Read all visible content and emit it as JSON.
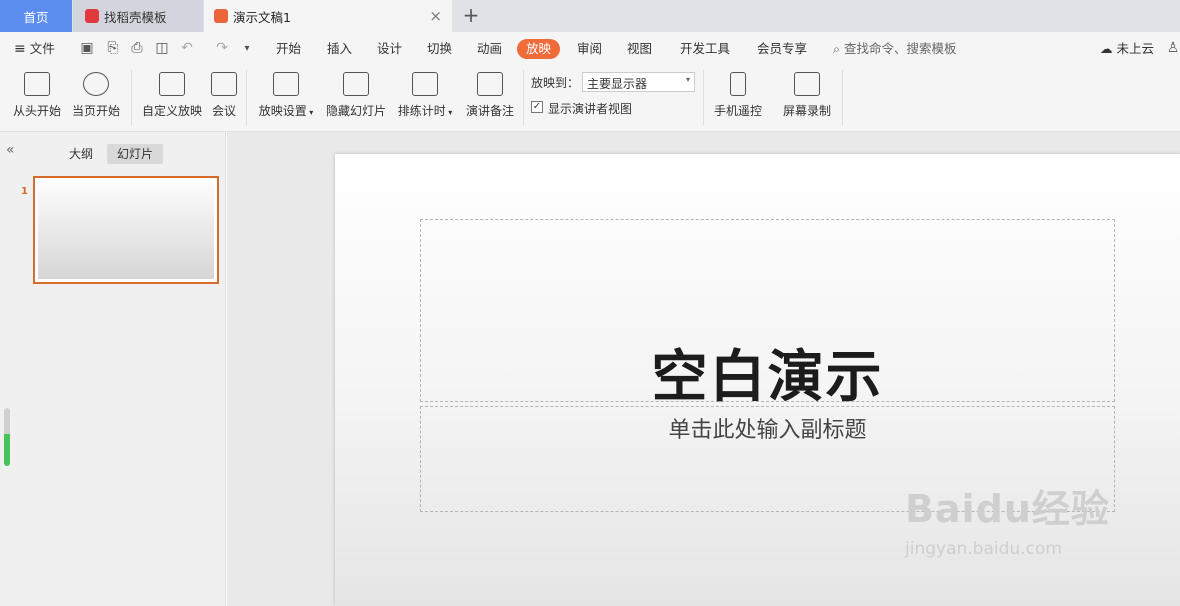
{
  "tabs": {
    "home": "首页",
    "template": "找稻壳模板",
    "document": "演示文稿1",
    "close": "×",
    "add": "+"
  },
  "menu": {
    "file": "文件",
    "items": [
      "开始",
      "插入",
      "设计",
      "切换",
      "动画",
      "放映",
      "审阅",
      "视图",
      "开发工具",
      "会员专享"
    ],
    "active_index": 5,
    "search_placeholder": "查找命令、搜索模板",
    "cloud": "未上云"
  },
  "ribbon": {
    "buttons": [
      "从头开始",
      "当页开始",
      "自定义放映",
      "会议",
      "放映设置",
      "隐藏幻灯片",
      "排练计时",
      "演讲备注",
      "手机遥控",
      "屏幕录制"
    ],
    "display_to_label": "放映到：",
    "display_to_value": "主要显示器",
    "presenter_view_label": "显示演讲者视图",
    "presenter_view_checked": true
  },
  "leftpanel": {
    "outline_tab": "大纲",
    "slides_tab": "幻灯片",
    "slide_number": "1"
  },
  "slide": {
    "title": "空白演示",
    "subtitle": "单击此处输入副标题"
  },
  "watermark": {
    "brand": "Baidu经验",
    "url": "jingyan.baidu.com"
  },
  "colors": {
    "accent": "#ef6b3a",
    "home_tab": "#5b8def",
    "selection_border": "#d56c2c"
  }
}
